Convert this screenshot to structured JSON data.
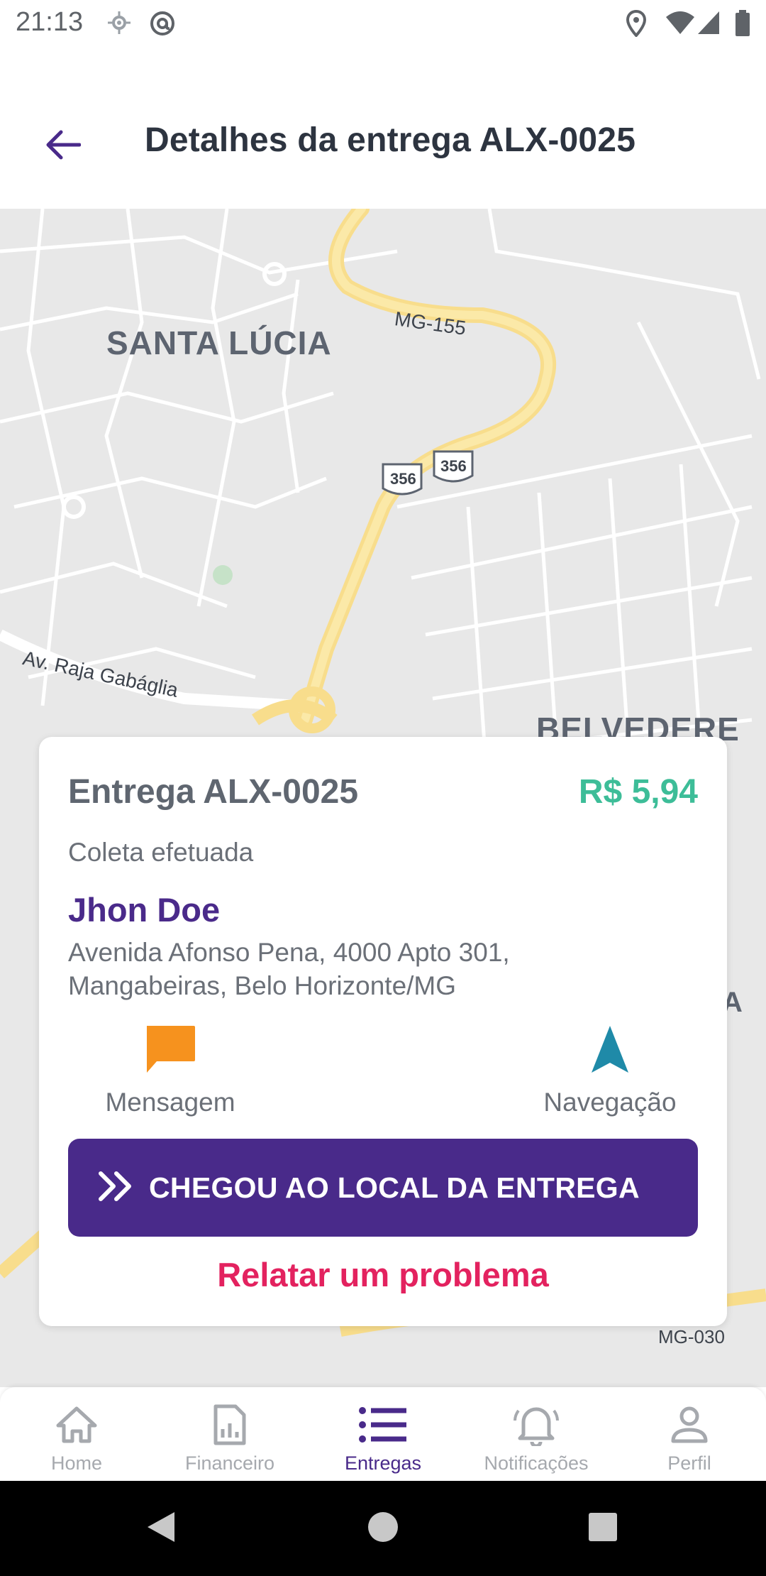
{
  "status_bar": {
    "time": "21:13",
    "icons": [
      "gps-icon",
      "at-icon",
      "location-icon",
      "wifi-icon",
      "signal-icon",
      "battery-icon"
    ]
  },
  "header": {
    "title": "Detalhes da entrega ALX-0025",
    "back_icon": "arrow-left-icon"
  },
  "map": {
    "labels": {
      "neighborhood_1": "SANTA LÚCIA",
      "neighborhood_2": "BELVEDERE",
      "road_1": "MG-155",
      "road_2": "Av. Raja Gabáglia",
      "road_3": "MG-030",
      "shield_1": "356",
      "shield_2": "356",
      "edge_letter": "A"
    }
  },
  "delivery_card": {
    "title": "Entrega ALX-0025",
    "price": "R$ 5,94",
    "status": "Coleta efetuada",
    "customer_name": "Jhon Doe",
    "address_line_1": "Avenida Afonso Pena, 4000 Apto 301,",
    "address_line_2": "Mangabeiras, Belo Horizonte/MG",
    "actions": {
      "message_label": "Mensagem",
      "navigation_label": "Navegação"
    },
    "primary_button_label": "CHEGOU AO LOCAL DA ENTREGA",
    "problem_link": "Relatar um problema"
  },
  "bottom_nav": {
    "items": [
      {
        "label": "Home",
        "icon": "home-icon",
        "active": false
      },
      {
        "label": "Financeiro",
        "icon": "report-icon",
        "active": false
      },
      {
        "label": "Entregas",
        "icon": "list-icon",
        "active": true
      },
      {
        "label": "Notificações",
        "icon": "bell-icon",
        "active": false
      },
      {
        "label": "Perfil",
        "icon": "person-icon",
        "active": false
      }
    ]
  },
  "colors": {
    "brand_purple": "#492a8a",
    "price_green": "#3dbd98",
    "alert_pink": "#e3225f",
    "message_orange": "#f6921e",
    "navigation_teal": "#1f8aa8"
  }
}
